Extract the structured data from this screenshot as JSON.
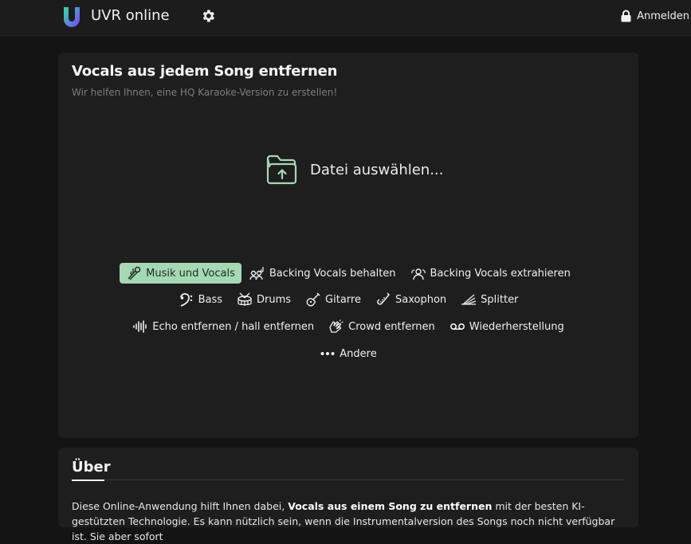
{
  "header": {
    "app_title": "UVR online",
    "login_label": "Anmelden",
    "logo_colors": [
      "#2ee0a0",
      "#7a3cff"
    ]
  },
  "main": {
    "title": "Vocals aus jedem Song entfernen",
    "subtitle": "Wir helfen Ihnen, eine HQ Karaoke-Version zu erstellen!",
    "file_select_label": "Datei auswählen...",
    "modes": [
      {
        "label": "Musik und Vocals",
        "icon": "music-vocals-icon",
        "active": true
      },
      {
        "label": "Backing Vocals behalten",
        "icon": "backing-vocals-keep-icon"
      },
      {
        "label": "Backing Vocals extrahieren",
        "icon": "backing-vocals-extract-icon"
      },
      {
        "label": "Bass",
        "icon": "bass-clef-icon"
      },
      {
        "label": "Drums",
        "icon": "drum-icon"
      },
      {
        "label": "Gitarre",
        "icon": "guitar-icon"
      },
      {
        "label": "Saxophon",
        "icon": "saxophone-icon"
      },
      {
        "label": "Splitter",
        "icon": "splitter-icon"
      },
      {
        "label": "Echo entfernen / hall entfernen",
        "icon": "waveform-icon"
      },
      {
        "label": "Crowd entfernen",
        "icon": "clapping-hands-icon"
      },
      {
        "label": "Wiederherstellung",
        "icon": "voicemail-icon"
      },
      {
        "label": "Andere",
        "icon": "more-dots-icon"
      }
    ],
    "accent_color": "#a6d8b4"
  },
  "about": {
    "title": "Über",
    "text_before": "Diese Online-Anwendung hilft Ihnen dabei, ",
    "text_bold": "Vocals aus einem Song zu entfernen",
    "text_after": " mit der besten KI-gestützten Technologie. Es kann nützlich sein, wenn die Instrumentalversion des Songs noch nicht verfügbar ist. Sie aber sofort"
  }
}
